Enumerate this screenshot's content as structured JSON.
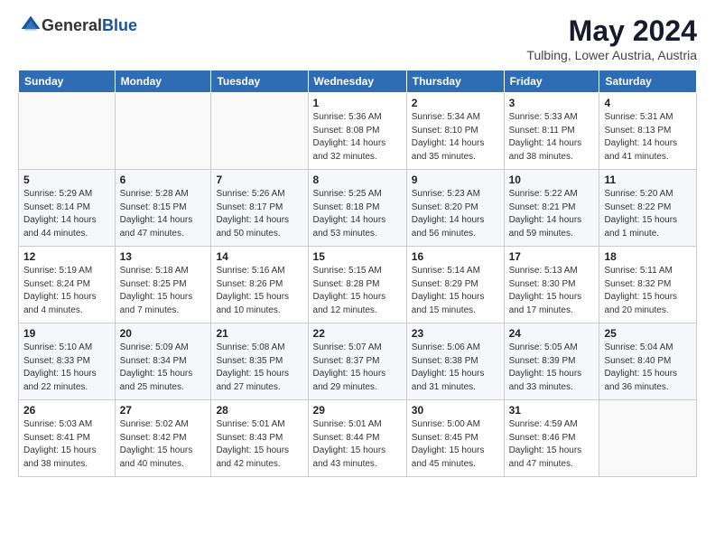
{
  "logo": {
    "general": "General",
    "blue": "Blue"
  },
  "title": {
    "month_year": "May 2024",
    "location": "Tulbing, Lower Austria, Austria"
  },
  "weekdays": [
    "Sunday",
    "Monday",
    "Tuesday",
    "Wednesday",
    "Thursday",
    "Friday",
    "Saturday"
  ],
  "weeks": [
    [
      {
        "day": "",
        "info": ""
      },
      {
        "day": "",
        "info": ""
      },
      {
        "day": "",
        "info": ""
      },
      {
        "day": "1",
        "info": "Sunrise: 5:36 AM\nSunset: 8:08 PM\nDaylight: 14 hours\nand 32 minutes."
      },
      {
        "day": "2",
        "info": "Sunrise: 5:34 AM\nSunset: 8:10 PM\nDaylight: 14 hours\nand 35 minutes."
      },
      {
        "day": "3",
        "info": "Sunrise: 5:33 AM\nSunset: 8:11 PM\nDaylight: 14 hours\nand 38 minutes."
      },
      {
        "day": "4",
        "info": "Sunrise: 5:31 AM\nSunset: 8:13 PM\nDaylight: 14 hours\nand 41 minutes."
      }
    ],
    [
      {
        "day": "5",
        "info": "Sunrise: 5:29 AM\nSunset: 8:14 PM\nDaylight: 14 hours\nand 44 minutes."
      },
      {
        "day": "6",
        "info": "Sunrise: 5:28 AM\nSunset: 8:15 PM\nDaylight: 14 hours\nand 47 minutes."
      },
      {
        "day": "7",
        "info": "Sunrise: 5:26 AM\nSunset: 8:17 PM\nDaylight: 14 hours\nand 50 minutes."
      },
      {
        "day": "8",
        "info": "Sunrise: 5:25 AM\nSunset: 8:18 PM\nDaylight: 14 hours\nand 53 minutes."
      },
      {
        "day": "9",
        "info": "Sunrise: 5:23 AM\nSunset: 8:20 PM\nDaylight: 14 hours\nand 56 minutes."
      },
      {
        "day": "10",
        "info": "Sunrise: 5:22 AM\nSunset: 8:21 PM\nDaylight: 14 hours\nand 59 minutes."
      },
      {
        "day": "11",
        "info": "Sunrise: 5:20 AM\nSunset: 8:22 PM\nDaylight: 15 hours\nand 1 minute."
      }
    ],
    [
      {
        "day": "12",
        "info": "Sunrise: 5:19 AM\nSunset: 8:24 PM\nDaylight: 15 hours\nand 4 minutes."
      },
      {
        "day": "13",
        "info": "Sunrise: 5:18 AM\nSunset: 8:25 PM\nDaylight: 15 hours\nand 7 minutes."
      },
      {
        "day": "14",
        "info": "Sunrise: 5:16 AM\nSunset: 8:26 PM\nDaylight: 15 hours\nand 10 minutes."
      },
      {
        "day": "15",
        "info": "Sunrise: 5:15 AM\nSunset: 8:28 PM\nDaylight: 15 hours\nand 12 minutes."
      },
      {
        "day": "16",
        "info": "Sunrise: 5:14 AM\nSunset: 8:29 PM\nDaylight: 15 hours\nand 15 minutes."
      },
      {
        "day": "17",
        "info": "Sunrise: 5:13 AM\nSunset: 8:30 PM\nDaylight: 15 hours\nand 17 minutes."
      },
      {
        "day": "18",
        "info": "Sunrise: 5:11 AM\nSunset: 8:32 PM\nDaylight: 15 hours\nand 20 minutes."
      }
    ],
    [
      {
        "day": "19",
        "info": "Sunrise: 5:10 AM\nSunset: 8:33 PM\nDaylight: 15 hours\nand 22 minutes."
      },
      {
        "day": "20",
        "info": "Sunrise: 5:09 AM\nSunset: 8:34 PM\nDaylight: 15 hours\nand 25 minutes."
      },
      {
        "day": "21",
        "info": "Sunrise: 5:08 AM\nSunset: 8:35 PM\nDaylight: 15 hours\nand 27 minutes."
      },
      {
        "day": "22",
        "info": "Sunrise: 5:07 AM\nSunset: 8:37 PM\nDaylight: 15 hours\nand 29 minutes."
      },
      {
        "day": "23",
        "info": "Sunrise: 5:06 AM\nSunset: 8:38 PM\nDaylight: 15 hours\nand 31 minutes."
      },
      {
        "day": "24",
        "info": "Sunrise: 5:05 AM\nSunset: 8:39 PM\nDaylight: 15 hours\nand 33 minutes."
      },
      {
        "day": "25",
        "info": "Sunrise: 5:04 AM\nSunset: 8:40 PM\nDaylight: 15 hours\nand 36 minutes."
      }
    ],
    [
      {
        "day": "26",
        "info": "Sunrise: 5:03 AM\nSunset: 8:41 PM\nDaylight: 15 hours\nand 38 minutes."
      },
      {
        "day": "27",
        "info": "Sunrise: 5:02 AM\nSunset: 8:42 PM\nDaylight: 15 hours\nand 40 minutes."
      },
      {
        "day": "28",
        "info": "Sunrise: 5:01 AM\nSunset: 8:43 PM\nDaylight: 15 hours\nand 42 minutes."
      },
      {
        "day": "29",
        "info": "Sunrise: 5:01 AM\nSunset: 8:44 PM\nDaylight: 15 hours\nand 43 minutes."
      },
      {
        "day": "30",
        "info": "Sunrise: 5:00 AM\nSunset: 8:45 PM\nDaylight: 15 hours\nand 45 minutes."
      },
      {
        "day": "31",
        "info": "Sunrise: 4:59 AM\nSunset: 8:46 PM\nDaylight: 15 hours\nand 47 minutes."
      },
      {
        "day": "",
        "info": ""
      }
    ]
  ]
}
